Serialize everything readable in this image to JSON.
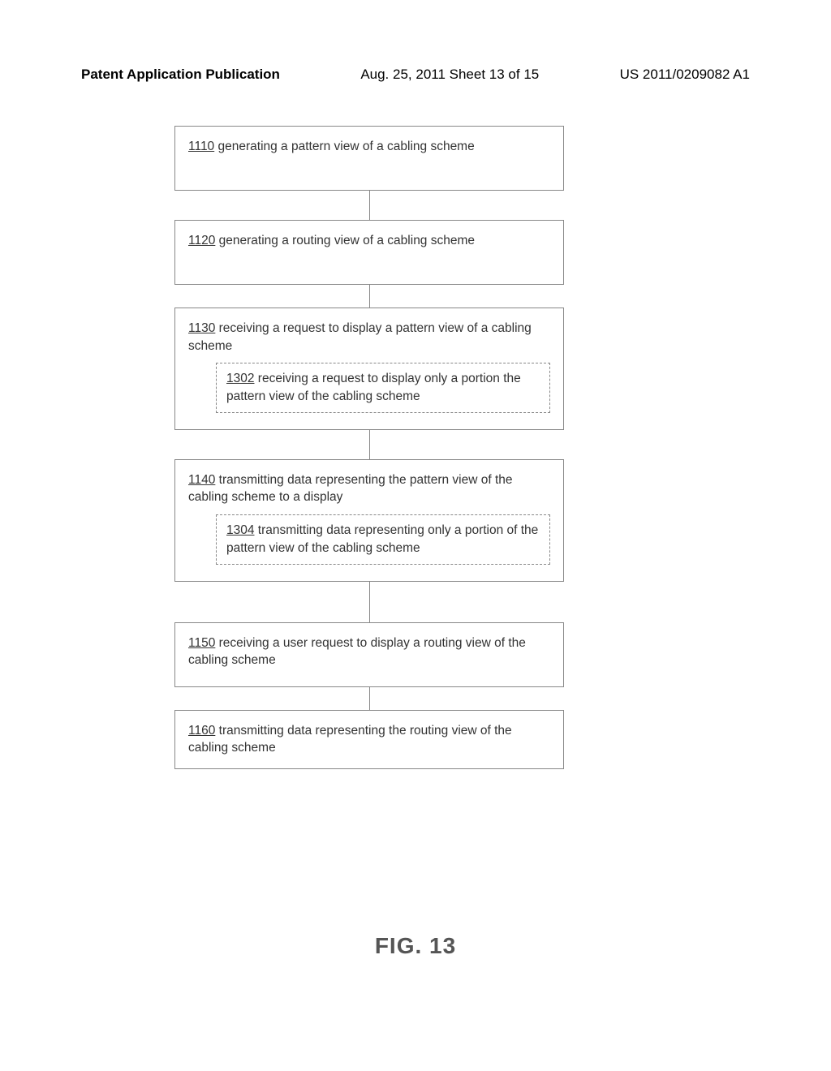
{
  "header": {
    "left": "Patent Application Publication",
    "center": "Aug. 25, 2011  Sheet 13 of 15",
    "right": "US 2011/0209082 A1"
  },
  "steps": {
    "s1110": {
      "ref": "1110",
      "text": " generating a pattern view of a cabling scheme"
    },
    "s1120": {
      "ref": "1120",
      "text": " generating a routing view of a cabling scheme"
    },
    "s1130": {
      "ref": "1130",
      "text": " receiving a request to display a pattern view of a cabling scheme",
      "sub": {
        "ref": "1302",
        "text": " receiving a request to display only a portion the pattern view of the cabling scheme"
      }
    },
    "s1140": {
      "ref": "1140",
      "text": " transmitting data representing the pattern view of the cabling scheme to a display",
      "sub": {
        "ref": "1304",
        "text": " transmitting data representing only a portion of the pattern view of the cabling scheme"
      }
    },
    "s1150": {
      "ref": "1150",
      "text": " receiving a user request to display a routing view of the cabling scheme"
    },
    "s1160": {
      "ref": "1160",
      "text": " transmitting data representing the routing view of the cabling scheme"
    }
  },
  "figure_label": "FIG. 13"
}
